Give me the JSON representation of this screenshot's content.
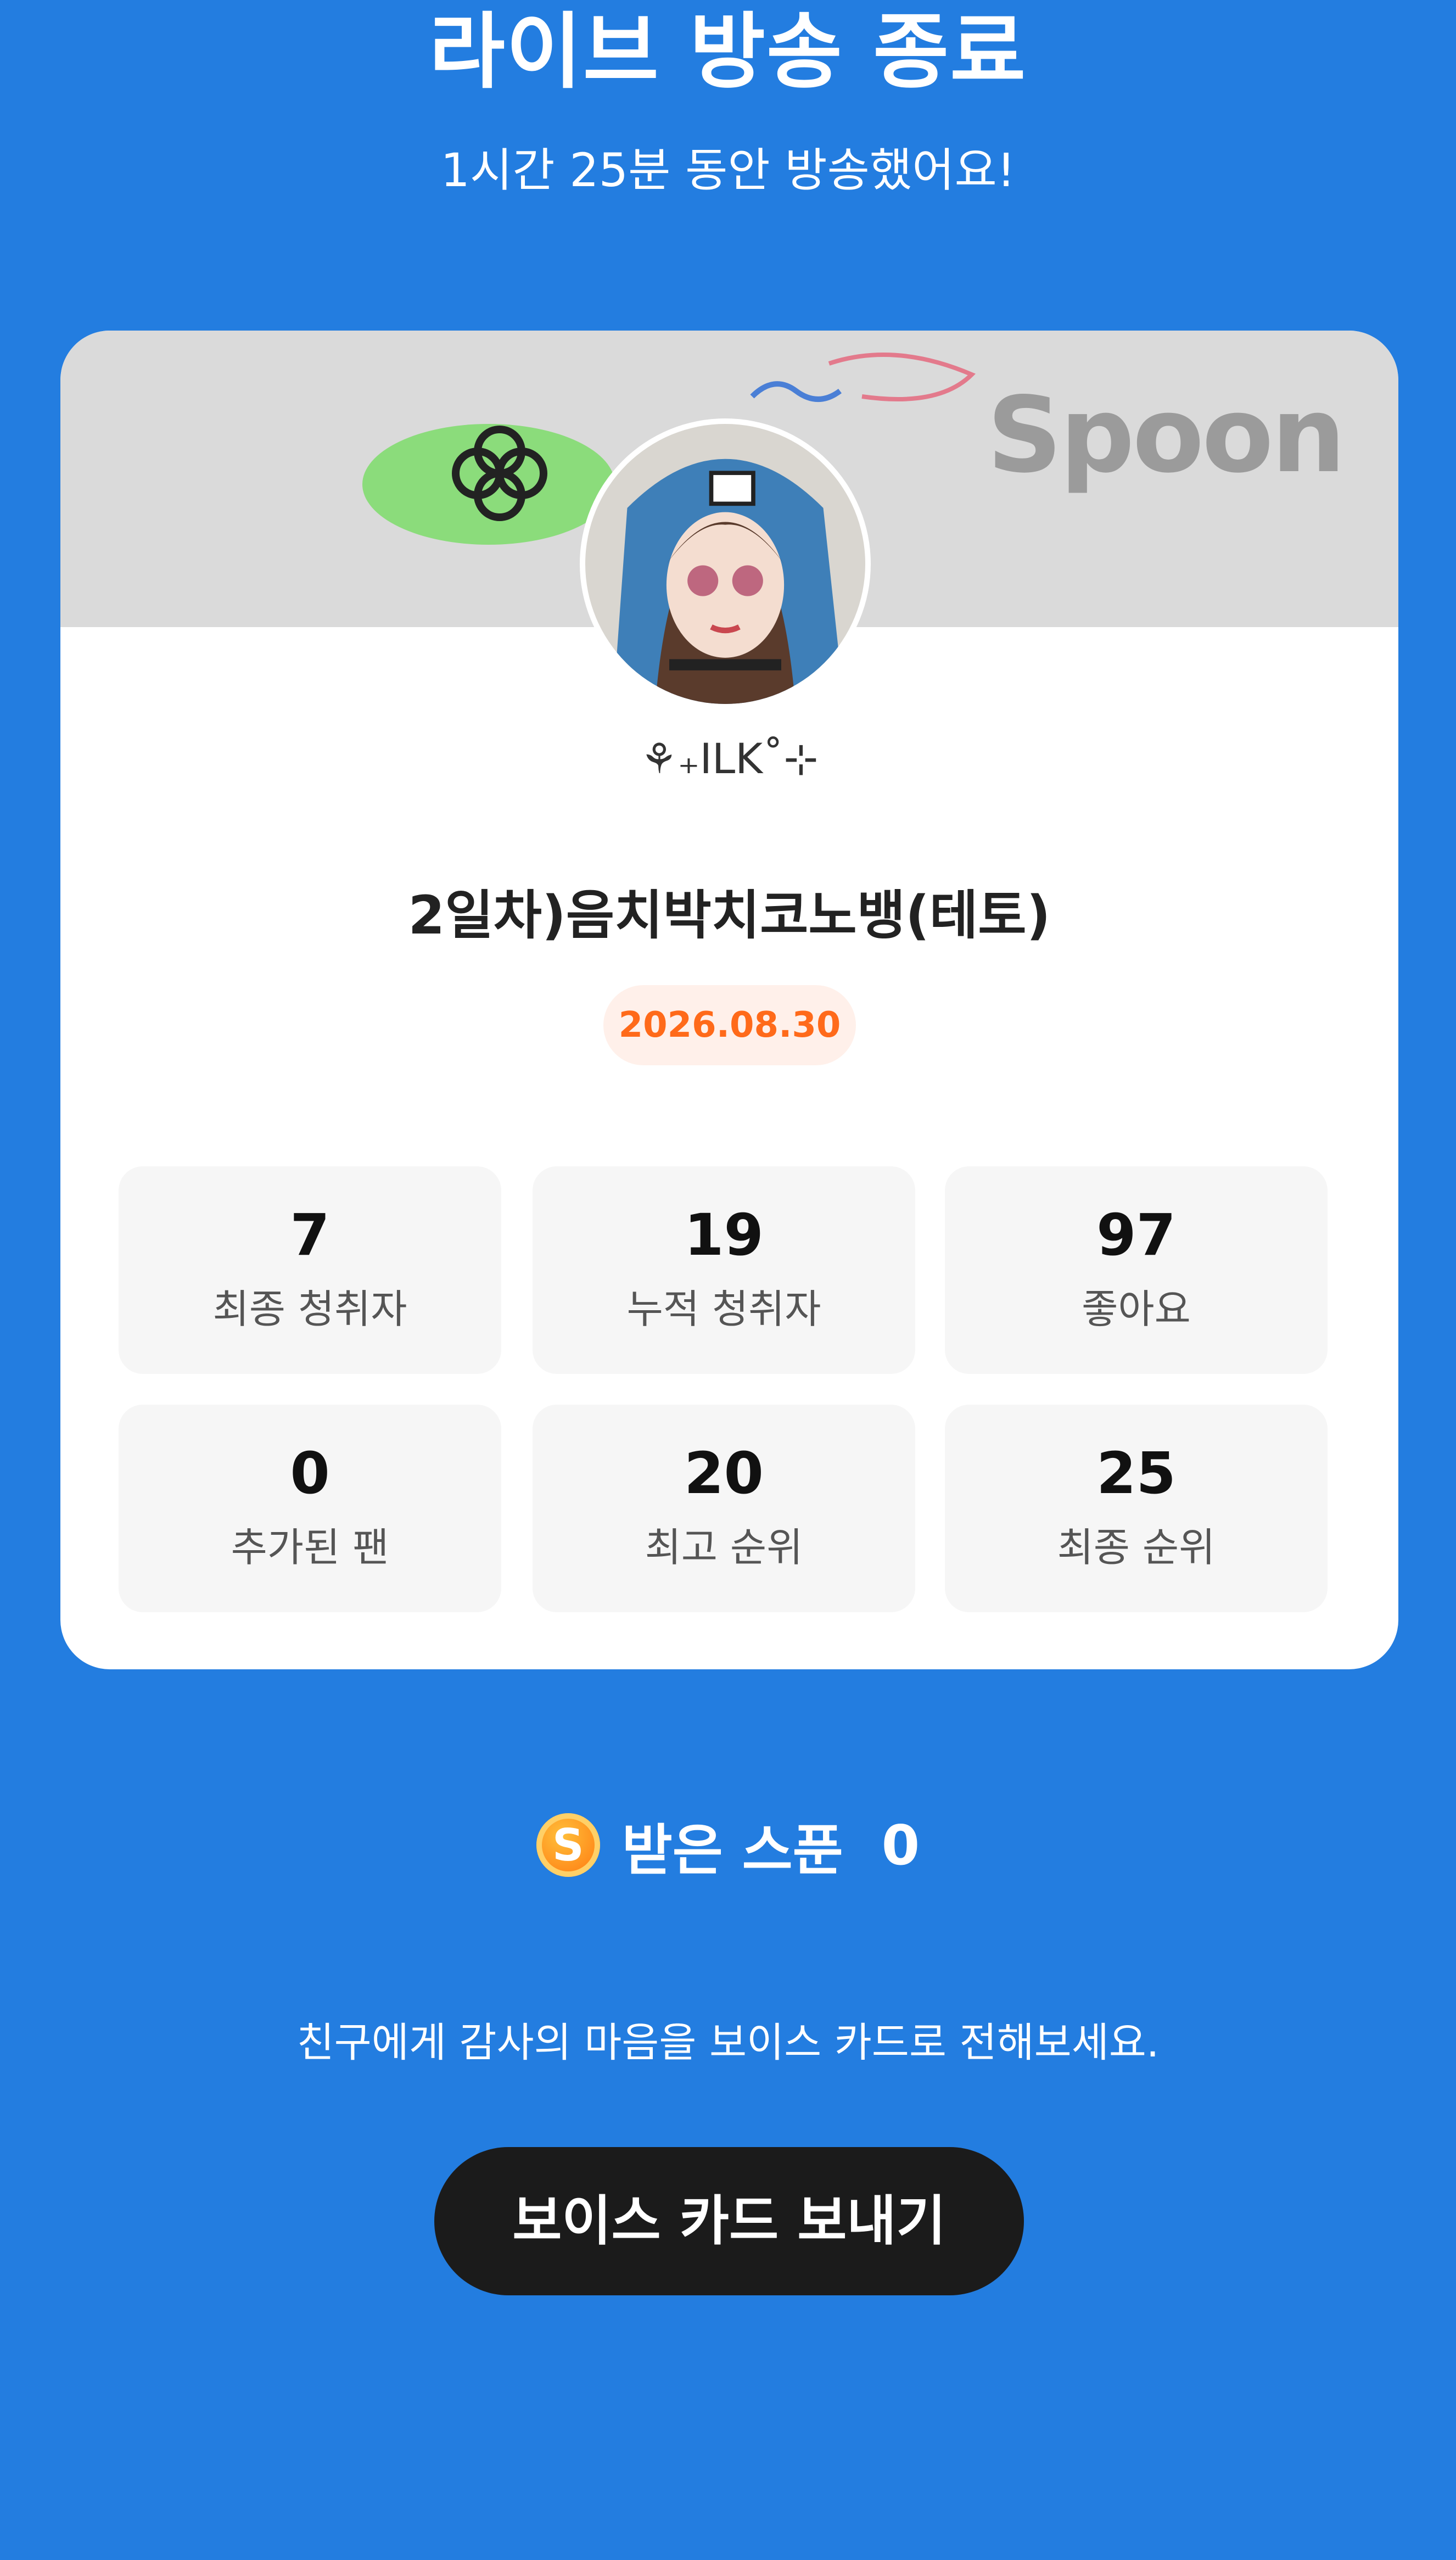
{
  "header": {
    "title": "라이브 방송 종료",
    "subtitle": "1시간 25분 동안 방송했어요!"
  },
  "card": {
    "banner_logo": "Spoon",
    "nickname": "⚘₊ILK˚⊹",
    "live_title": "2일차)음치박치코노뱅(테토)",
    "date": "2026.08.30",
    "stats": [
      {
        "value": "7",
        "label": "최종 청취자"
      },
      {
        "value": "19",
        "label": "누적 청취자"
      },
      {
        "value": "97",
        "label": "좋아요"
      },
      {
        "value": "0",
        "label": "추가된 팬"
      },
      {
        "value": "20",
        "label": "최고 순위"
      },
      {
        "value": "25",
        "label": "최종 순위"
      }
    ]
  },
  "spoon": {
    "coin_letter": "S",
    "label": "받은 스푼",
    "count": "0"
  },
  "footer": {
    "message": "친구에게 감사의 마음을 보이스 카드로 전해보세요.",
    "button_label": "보이스 카드 보내기"
  },
  "colors": {
    "background": "#237de0",
    "date_text": "#ff6a1a",
    "button": "#1b1b1b"
  }
}
